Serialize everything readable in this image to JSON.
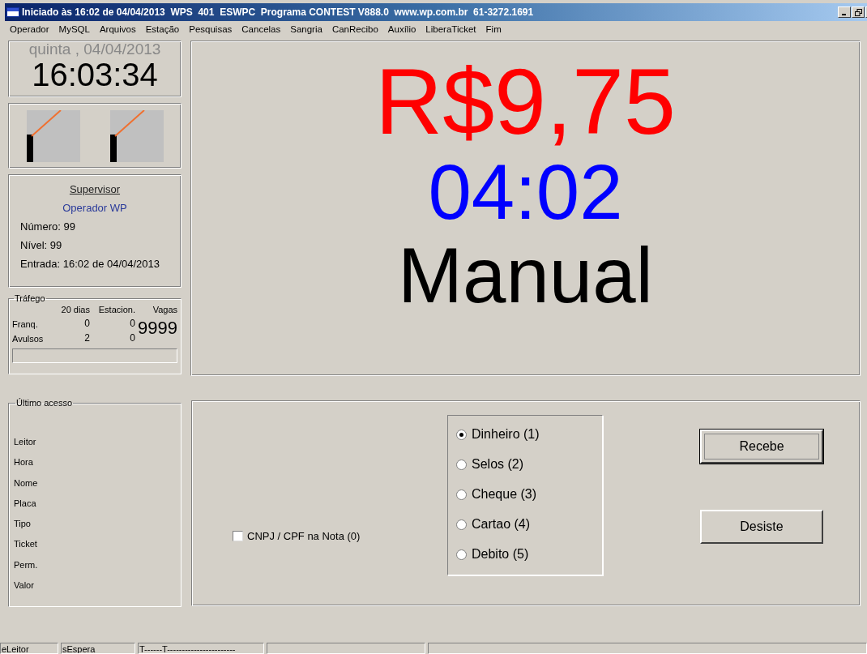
{
  "window": {
    "title": "Iniciado às 16:02 de 04/04/2013  WPS  401  ESWPC  Programa CONTEST V888.0  www.wp.com.br  61-3272.1691"
  },
  "menu": [
    "Operador",
    "MySQL",
    "Arquivos",
    "Estação",
    "Pesquisas",
    "Cancelas",
    "Sangria",
    "CanRecibo",
    "Auxílio",
    "LiberaTicket",
    "Fim"
  ],
  "clock": {
    "date": "quinta , 04/04/2013",
    "time": "16:03:34"
  },
  "operator": {
    "role": "Supervisor",
    "name": "Operador WP",
    "lines": [
      "Número: 99",
      "Nível: 99",
      "Entrada: 16:02 de 04/04/2013"
    ]
  },
  "traffic": {
    "title": "Tráfego",
    "columns": [
      "20 dias",
      "Estacion.",
      "Vagas"
    ],
    "rows": [
      {
        "label": "Franq.",
        "days": "0",
        "parked": "0"
      },
      {
        "label": "Avulsos",
        "days": "2",
        "parked": "0"
      }
    ],
    "vacancies": "9999"
  },
  "last_access": {
    "title": "Último acesso",
    "fields": [
      "Leitor",
      "Hora",
      "Nome",
      "Placa",
      "Tipo",
      "Ticket",
      "Perm.",
      "Valor"
    ]
  },
  "display": {
    "amount": "R$9,75",
    "duration": "04:02",
    "mode": "Manual"
  },
  "payment": {
    "nota_checkbox": {
      "label": "CNPJ / CPF na Nota (0)",
      "checked": false
    },
    "methods": [
      {
        "label": "Dinheiro (1)",
        "selected": true
      },
      {
        "label": "Selos (2)",
        "selected": false
      },
      {
        "label": "Cheque (3)",
        "selected": false
      },
      {
        "label": "Cartao (4)",
        "selected": false
      },
      {
        "label": "Debito (5)",
        "selected": false
      }
    ],
    "buttons": [
      {
        "label": "Recebe",
        "default": true
      },
      {
        "label": "Desiste",
        "default": false
      }
    ]
  },
  "status_bar": [
    "eLeitor",
    "sEspera",
    "T------T-----------------------"
  ]
}
